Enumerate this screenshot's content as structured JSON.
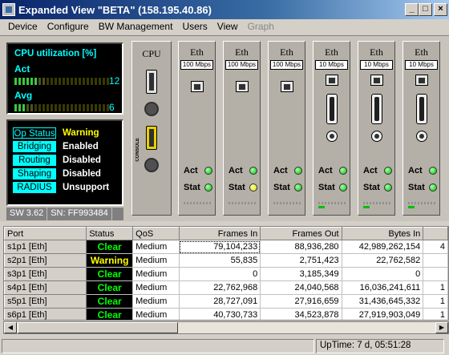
{
  "window": {
    "title": "Expanded View \"BETA\" (158.195.40.86)",
    "minimize": "_",
    "maximize": "□",
    "close": "×"
  },
  "menu": [
    {
      "label": "Device",
      "enabled": true
    },
    {
      "label": "Configure",
      "enabled": true
    },
    {
      "label": "BW Management",
      "enabled": true
    },
    {
      "label": "Users",
      "enabled": true
    },
    {
      "label": "View",
      "enabled": true
    },
    {
      "label": "Graph",
      "enabled": false
    }
  ],
  "cpu_panel": {
    "title": "CPU utilization [%]",
    "act_label": "Act",
    "act_value": "12",
    "avg_label": "Avg",
    "avg_value": "6"
  },
  "status_panel": {
    "rows": [
      {
        "label": "Op Status",
        "value": "Warning"
      },
      {
        "label": "Bridging",
        "value": "Enabled"
      },
      {
        "label": "Routing",
        "value": "Disabled"
      },
      {
        "label": "Shaping",
        "value": "Disabled"
      },
      {
        "label": "RADIUS",
        "value": "Unsupport"
      }
    ],
    "sw": "SW 3.62",
    "sn": "SN: FF993484"
  },
  "cards": {
    "cpu": {
      "title": "CPU",
      "console": "CONSOLE"
    },
    "ports": [
      {
        "title": "Eth",
        "speed": "100 Mbps",
        "act": "Act",
        "stat": "Stat",
        "act_led": "green",
        "stat_led": "green"
      },
      {
        "title": "Eth",
        "speed": "100 Mbps",
        "act": "Act",
        "stat": "Stat",
        "act_led": "green",
        "stat_led": "yellow"
      },
      {
        "title": "Eth",
        "speed": "100 Mbps",
        "act": "Act",
        "stat": "Stat",
        "act_led": "green",
        "stat_led": "green"
      },
      {
        "title": "Eth",
        "speed": "10 Mbps",
        "act": "Act",
        "stat": "Stat",
        "act_led": "green",
        "stat_led": "green"
      },
      {
        "title": "Eth",
        "speed": "10 Mbps",
        "act": "Act",
        "stat": "Stat",
        "act_led": "green",
        "stat_led": "green"
      },
      {
        "title": "Eth",
        "speed": "10 Mbps",
        "act": "Act",
        "stat": "Stat",
        "act_led": "green",
        "stat_led": "green"
      }
    ]
  },
  "table": {
    "headers": [
      "Port",
      "Status",
      "QoS",
      "Frames In",
      "Frames Out",
      "Bytes In"
    ],
    "rows": [
      {
        "port": "s1p1  [Eth]",
        "status": "Clear",
        "qos": "Medium",
        "frames_in": "79,104,233",
        "frames_out": "88,936,280",
        "bytes_in": "42,989,262,154",
        "more": "4"
      },
      {
        "port": "s2p1  [Eth]",
        "status": "Warning",
        "qos": "Medium",
        "frames_in": "55,835",
        "frames_out": "2,751,423",
        "bytes_in": "22,762,582",
        "more": ""
      },
      {
        "port": "s3p1  [Eth]",
        "status": "Clear",
        "qos": "Medium",
        "frames_in": "0",
        "frames_out": "3,185,349",
        "bytes_in": "0",
        "more": ""
      },
      {
        "port": "s4p1  [Eth]",
        "status": "Clear",
        "qos": "Medium",
        "frames_in": "22,762,968",
        "frames_out": "24,040,568",
        "bytes_in": "16,036,241,611",
        "more": "1"
      },
      {
        "port": "s5p1  [Eth]",
        "status": "Clear",
        "qos": "Medium",
        "frames_in": "28,727,091",
        "frames_out": "27,916,659",
        "bytes_in": "31,436,645,332",
        "more": "1"
      },
      {
        "port": "s6p1  [Eth]",
        "status": "Clear",
        "qos": "Medium",
        "frames_in": "40,730,733",
        "frames_out": "34,523,878",
        "bytes_in": "27,919,903,049",
        "more": "1"
      }
    ]
  },
  "statusbar": {
    "uptime": "UpTime:  7 d, 05:51:28"
  },
  "colors": {
    "ok": "#00ff00",
    "warn": "#ffff00",
    "panel_text": "#00ffff"
  }
}
